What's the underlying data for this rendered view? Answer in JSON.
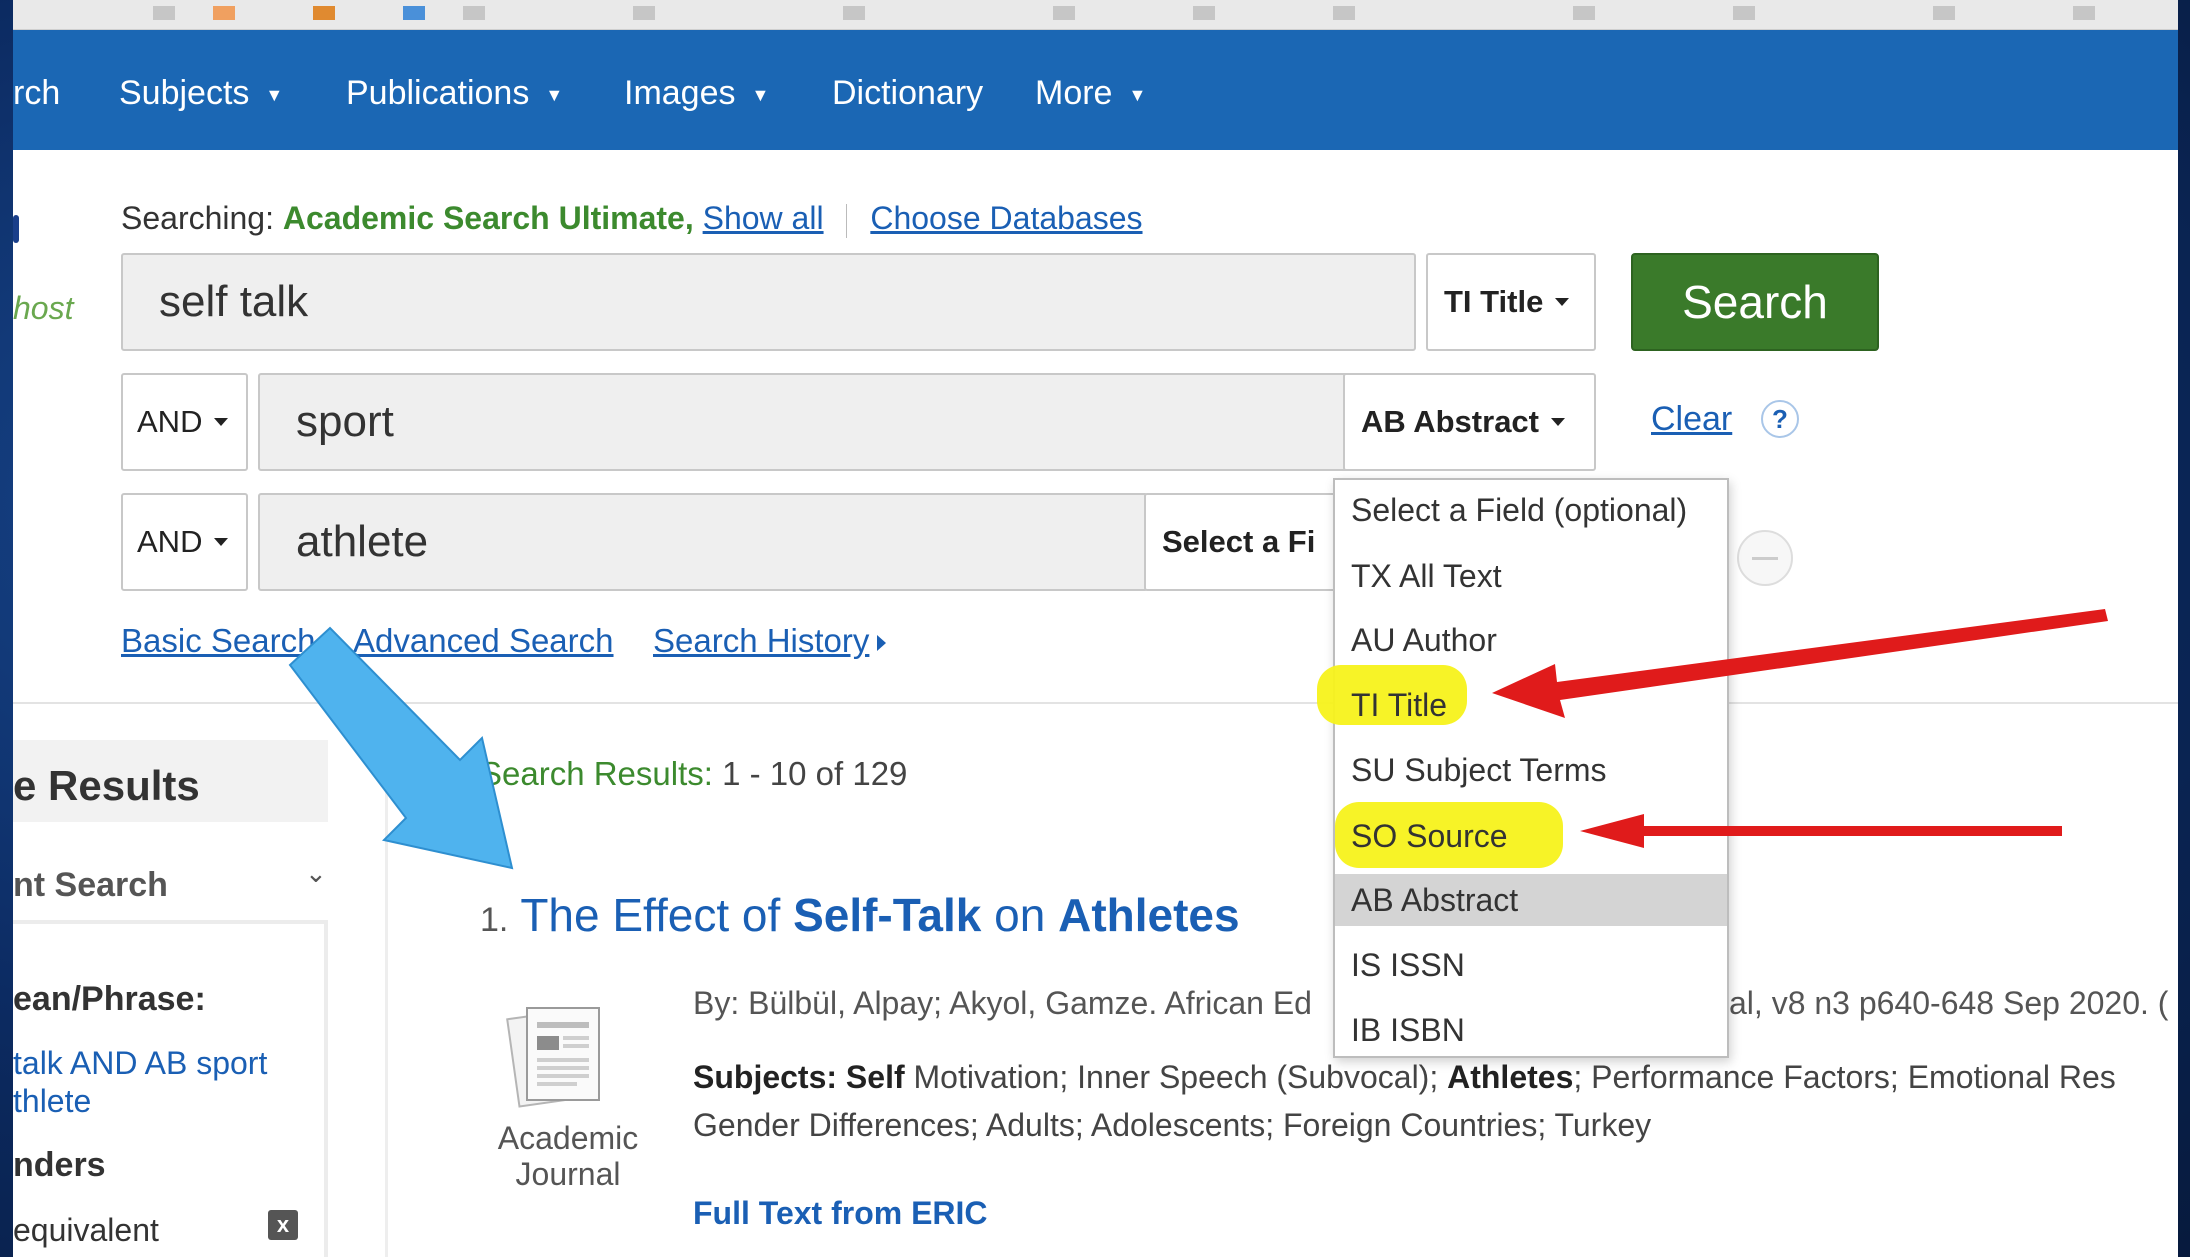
{
  "nav": {
    "items": [
      {
        "label": "rch",
        "caret": false
      },
      {
        "label": "Subjects",
        "caret": true
      },
      {
        "label": "Publications",
        "caret": true
      },
      {
        "label": "Images",
        "caret": true
      },
      {
        "label": "Dictionary",
        "caret": false
      },
      {
        "label": "More",
        "caret": true
      }
    ]
  },
  "brand": "host",
  "searching": {
    "prefix": "Searching:",
    "database": "Academic Search Ultimate,",
    "show_all": "Show all",
    "choose": "Choose Databases"
  },
  "search_rows": [
    {
      "bool": "",
      "value": "self talk",
      "field": "TI Title"
    },
    {
      "bool": "AND",
      "value": "sport",
      "field": "AB Abstract"
    },
    {
      "bool": "AND",
      "value": "athlete",
      "field": "Select a Fi"
    }
  ],
  "search_button": "Search",
  "clear_link": "Clear",
  "help_icon": "?",
  "links": {
    "basic": "Basic Search",
    "advanced": "Advanced Search",
    "history": "Search History"
  },
  "dropdown": {
    "options": [
      "Select a Field (optional)",
      "TX All Text",
      "AU Author",
      "TI Title",
      "SU Subject Terms",
      "SO Source",
      "AB Abstract",
      "IS ISSN",
      "IB ISBN"
    ],
    "selected": "AB Abstract",
    "highlighted": [
      "TI Title",
      "SO Source"
    ]
  },
  "sidebar": {
    "header": "e Results",
    "current_search": "nt Search",
    "boolean_label": "ean/Phrase:",
    "query_line1": "talk AND AB sport",
    "query_line2": "thlete",
    "expanders": "nders",
    "equivalent": "equivalent",
    "close_icon": "x"
  },
  "results": {
    "count_label": "Search Results:",
    "count_value": "1 - 10 of 129",
    "item": {
      "number": "1.",
      "title_parts": [
        "The Effect of ",
        "Self-Talk",
        " on ",
        "Athletes"
      ],
      "byline_left": "By: Bülbül, Alpay; Akyol, Gamze. African Ed",
      "byline_right": "al, v8 n3 p640-648 Sep 2020. (",
      "subjects_label": "Subjects:",
      "subjects_bold": "Self",
      "subjects_rest": " Motivation; Inner Speech (Subvocal); ",
      "subjects_bold2": "Athletes",
      "subjects_tail": "; Performance Factors; Emotional Res",
      "subjects_line2": "Gender Differences; Adults; Adolescents; Foreign Countries; Turkey",
      "type_line1": "Academic",
      "type_line2": "Journal",
      "full_text": "Full Text from ERIC"
    }
  },
  "annotation_colors": {
    "arrow_blue": "#4fb3ee",
    "arrow_red": "#e01b1b",
    "highlight_yellow": "#f7f21b"
  }
}
